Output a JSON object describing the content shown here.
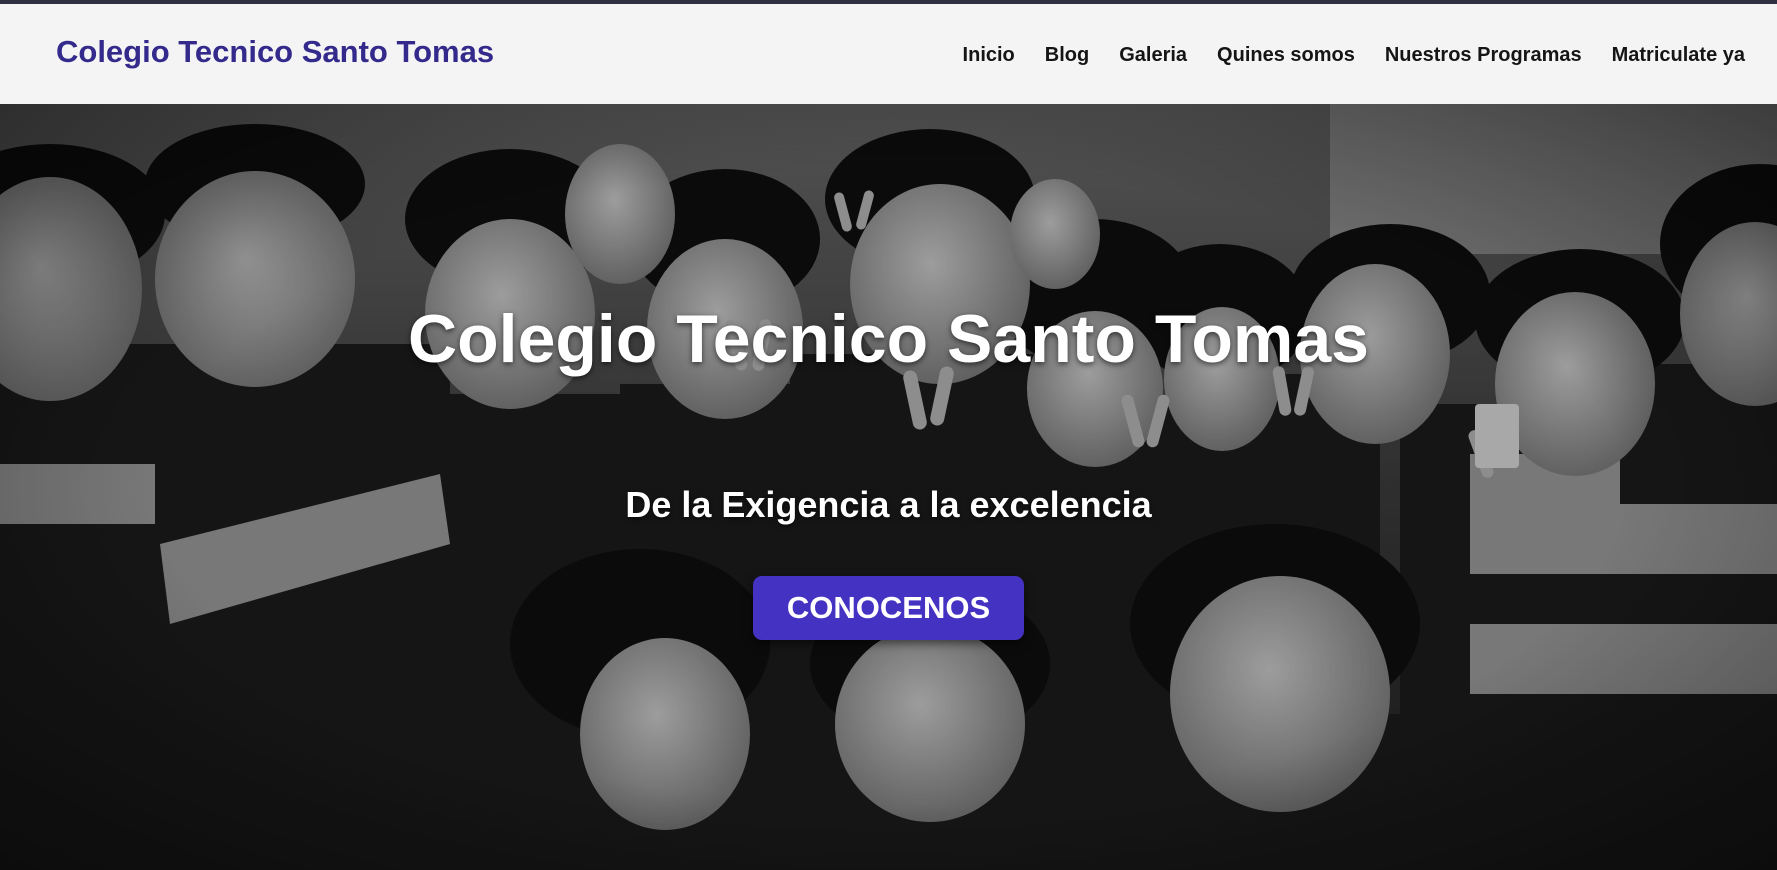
{
  "colors": {
    "brand": "#332a8c",
    "button": "#4432c2",
    "nav_bg": "#f4f4f4"
  },
  "navbar": {
    "brand": "Colegio Tecnico Santo Tomas",
    "links": [
      "Inicio",
      "Blog",
      "Galeria",
      "Quines somos",
      "Nuestros Programas",
      "Matriculate ya"
    ]
  },
  "hero": {
    "title": "Colegio Tecnico Santo Tomas",
    "subtitle": "De la Exigencia a la excelencia",
    "cta_label": "CONOCENOS",
    "image_icon": "group-of-children-photo"
  }
}
